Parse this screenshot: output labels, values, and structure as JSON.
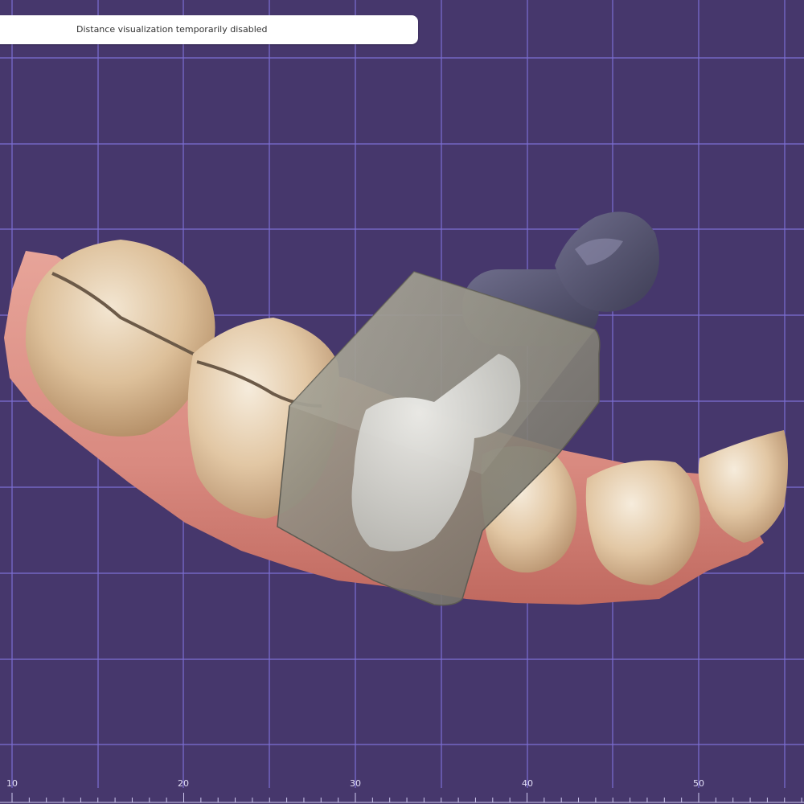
{
  "notice": {
    "text": "Distance visualization temporarily disabled"
  },
  "ruler": {
    "labels": [
      "10",
      "20",
      "30",
      "40",
      "50"
    ]
  },
  "colors": {
    "background": "#46376c",
    "grid": "#7c6fd4",
    "gum": "#d98a80",
    "tooth": "#e2c7a4",
    "milling_block": "#8a877c",
    "holder": "#4c4b66",
    "crown": "#d8d8d8"
  },
  "icons": {
    "ruler": "horizontal-mm-scale"
  }
}
